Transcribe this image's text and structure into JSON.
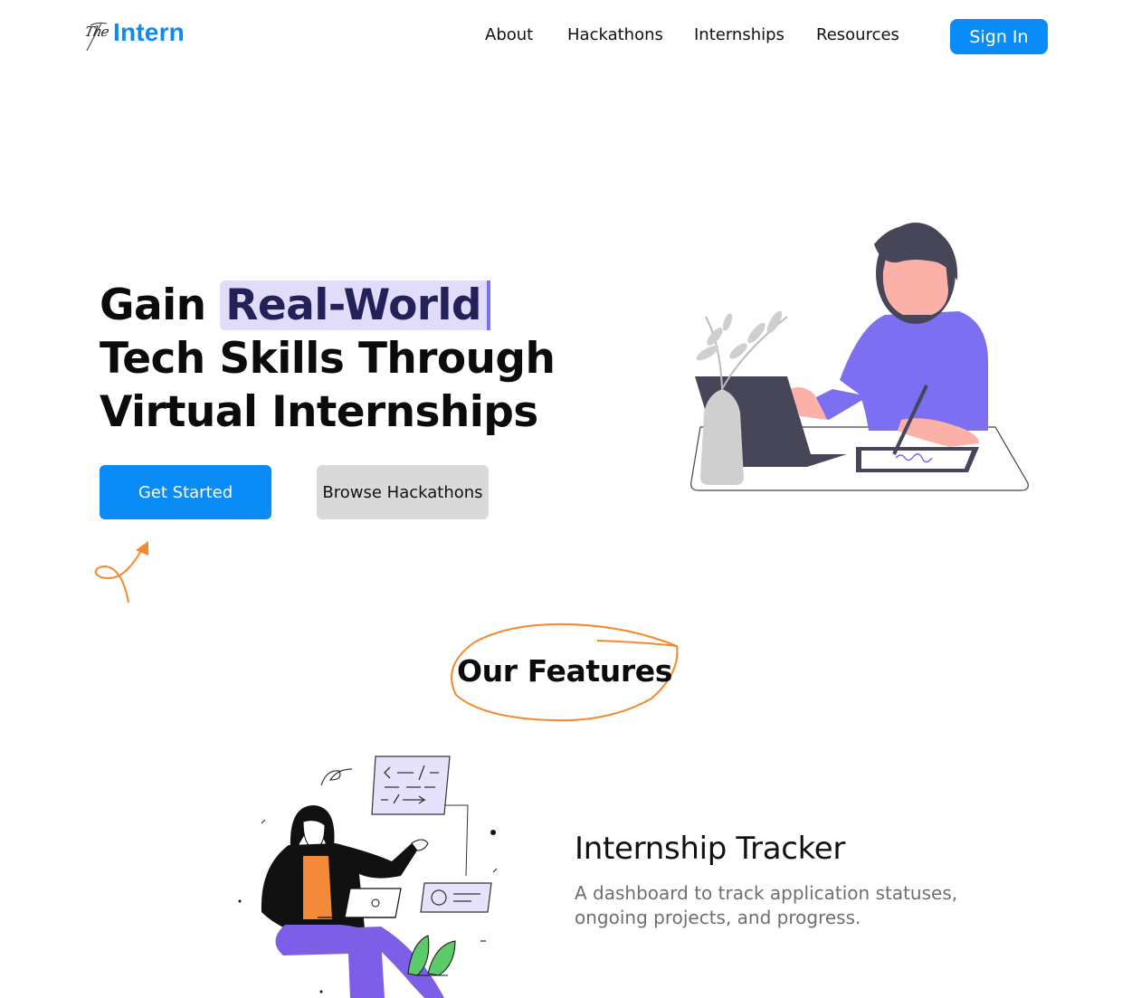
{
  "header": {
    "logo_prefix": "The",
    "logo_text": "Intern",
    "nav": [
      "About",
      "Hackathons",
      "Internships",
      "Resources"
    ],
    "signin_label": "Sign In"
  },
  "hero": {
    "title_before": "Gain ",
    "title_highlight": "Real-World",
    "title_after": " Tech Skills Through Virtual Internships",
    "primary_button": "Get Started",
    "secondary_button": "Browse Hackathons"
  },
  "features": {
    "heading": "Our Features",
    "items": [
      {
        "title": "Internship Tracker",
        "description": "A dashboard to track application statuses, ongoing projects, and progress."
      }
    ]
  },
  "colors": {
    "brand_blue": "#0a8cf8",
    "highlight_bg": "#e2dcfb",
    "accent_purple": "#7b70f2",
    "doodle_orange": "#f28a2e"
  }
}
